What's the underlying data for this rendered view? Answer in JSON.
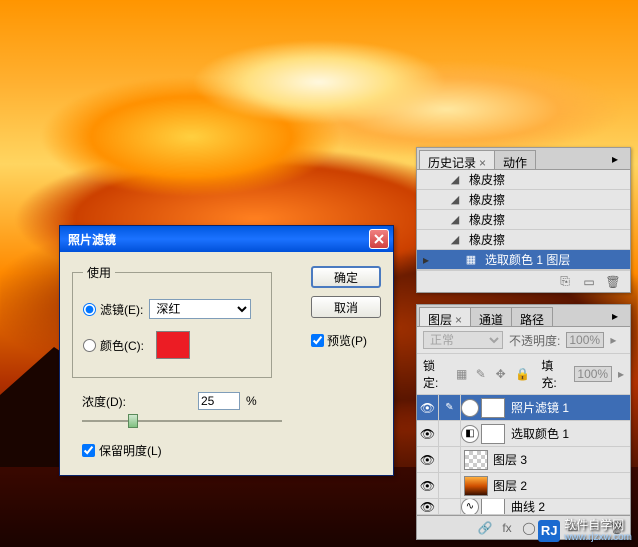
{
  "dialog": {
    "title": "照片滤镜",
    "use_legend": "使用",
    "filter_label": "滤镜(E):",
    "filter_value": "深红",
    "color_label": "颜色(C):",
    "color_swatch": "#ec1c24",
    "density_label": "浓度(D):",
    "density_value": "25",
    "density_pct": "%",
    "preserve_label": "保留明度(L)",
    "ok": "确定",
    "cancel": "取消",
    "preview": "预览(P)",
    "use_mode": "filter",
    "preserve_checked": true,
    "preview_checked": true
  },
  "history": {
    "tab_history": "历史记录",
    "tab_actions": "动作",
    "items": [
      {
        "icon": "eraser",
        "label": "橡皮擦"
      },
      {
        "icon": "eraser",
        "label": "橡皮擦"
      },
      {
        "icon": "eraser",
        "label": "橡皮擦"
      },
      {
        "icon": "eraser",
        "label": "橡皮擦"
      },
      {
        "icon": "adjust",
        "label": "选取颜色 1 图层",
        "selected": true
      }
    ]
  },
  "layers": {
    "tab_layers": "图层",
    "tab_channels": "通道",
    "tab_paths": "路径",
    "blend_mode": "正常",
    "opacity_label": "不透明度:",
    "opacity_value": "100%",
    "lock_label": "锁定:",
    "fill_label": "填充:",
    "fill_value": "100%",
    "rows": [
      {
        "name": "照片滤镜 1",
        "type": "adjustment",
        "selected": true,
        "visible": true
      },
      {
        "name": "选取颜色 1",
        "type": "adjustment",
        "visible": true
      },
      {
        "name": "图层 3",
        "type": "raster-checker",
        "visible": true
      },
      {
        "name": "图层 2",
        "type": "raster-sunset",
        "visible": true
      },
      {
        "name": "曲线 2",
        "type": "adjustment",
        "visible": true,
        "partial": true
      }
    ]
  },
  "watermark": {
    "logo": "RJ",
    "text": "软件自学网",
    "url": "www.rjzxw.com"
  }
}
